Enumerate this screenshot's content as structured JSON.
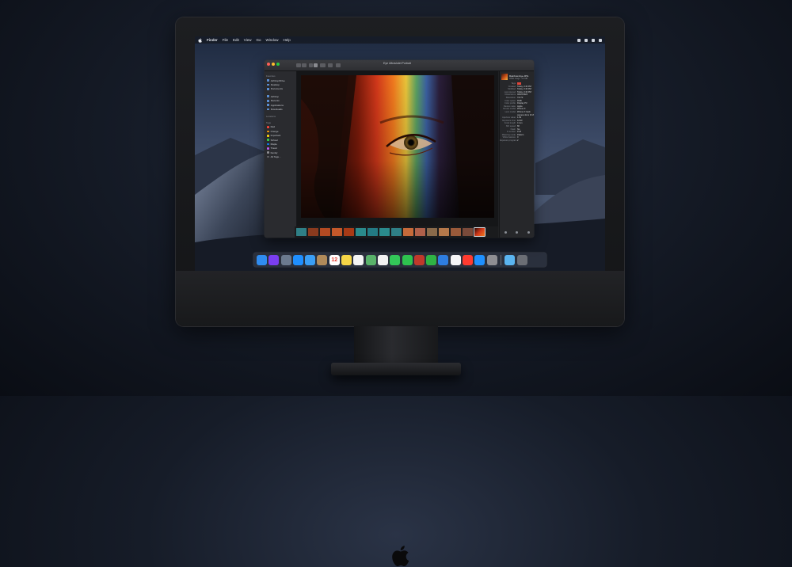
{
  "menubar": {
    "app_name": "Finder",
    "items": [
      "File",
      "Edit",
      "View",
      "Go",
      "Window",
      "Help"
    ]
  },
  "window": {
    "title": "Eye Ultraviolet Portrait",
    "sidebar": {
      "sections": [
        {
          "title": "Favorites",
          "items": [
            "AirDrop/Drive",
            "Desktop",
            "Documents"
          ]
        },
        {
          "title": "",
          "items": [
            "AirDrop",
            "Recents",
            "Applications",
            "Downloads"
          ]
        },
        {
          "title": "Locations",
          "items": []
        },
        {
          "title": "Tags",
          "tags": [
            {
              "label": "Red",
              "color": "#ff453a"
            },
            {
              "label": "Orange",
              "color": "#ff9f0a"
            },
            {
              "label": "Important",
              "color": "#ffd60a"
            },
            {
              "label": "School",
              "color": "#32d74b"
            },
            {
              "label": "Maple",
              "color": "#0a84ff"
            },
            {
              "label": "Travel",
              "color": "#bf5af2"
            },
            {
              "label": "Family",
              "color": "#8e8e93"
            },
            {
              "label": "All Tags...",
              "color": "#636366"
            }
          ]
        }
      ]
    },
    "inspector": {
      "file_name": "Rainbow Eye.JPG",
      "file_info": "JPEG image · 9.6 MB",
      "rows": [
        {
          "k": "Tags",
          "v": ""
        },
        {
          "k": "Created",
          "v": "Today, 3:40 PM"
        },
        {
          "k": "Modified",
          "v": "Today, 3:40 PM"
        },
        {
          "k": "Last opened",
          "v": "Today, 3:40 PM"
        },
        {
          "k": "Dimensions",
          "v": "4032×3024"
        },
        {
          "k": "Resolution",
          "v": "72×72"
        },
        {
          "k": "Color space",
          "v": "RGB"
        },
        {
          "k": "Color profile",
          "v": "Display P3"
        },
        {
          "k": "Device make",
          "v": "Apple"
        },
        {
          "k": "Device model",
          "v": "iPhone X"
        },
        {
          "k": "Lens model",
          "v": "iPhone X back"
        },
        {
          "k": "",
          "v": "camera 4mm f/1.8"
        },
        {
          "k": "Aperture value",
          "v": "1.69"
        },
        {
          "k": "Exposure time",
          "v": "1/120"
        },
        {
          "k": "Focal length",
          "v": "4 mm"
        },
        {
          "k": "ISO speed",
          "v": "80"
        },
        {
          "k": "Flash",
          "v": "No"
        },
        {
          "k": "F number",
          "v": "f/1.8"
        },
        {
          "k": "Metering mode",
          "v": "Pattern"
        },
        {
          "k": "White balance",
          "v": "0"
        },
        {
          "k": "Exposure program",
          "v": "2"
        }
      ]
    },
    "thumbnail_count": 16,
    "selected_thumbnail": 15
  },
  "dock": {
    "apps": [
      {
        "name": "Finder",
        "color": "#2f8cf0",
        "glyph": ""
      },
      {
        "name": "Siri",
        "color": "#7a3ef0",
        "glyph": ""
      },
      {
        "name": "Launchpad",
        "color": "#6b7a8f",
        "glyph": ""
      },
      {
        "name": "Safari",
        "color": "#1f8fff",
        "glyph": ""
      },
      {
        "name": "Mail",
        "color": "#3a9ef5",
        "glyph": ""
      },
      {
        "name": "Contacts",
        "color": "#b08a5a",
        "glyph": ""
      },
      {
        "name": "Calendar",
        "color": "#ffffff",
        "glyph": "12"
      },
      {
        "name": "Notes",
        "color": "#f5d547",
        "glyph": ""
      },
      {
        "name": "Reminders",
        "color": "#f4f4f4",
        "glyph": ""
      },
      {
        "name": "Maps",
        "color": "#59b26a",
        "glyph": ""
      },
      {
        "name": "Photos",
        "color": "#f2f2f2",
        "glyph": ""
      },
      {
        "name": "Messages",
        "color": "#33c759",
        "glyph": ""
      },
      {
        "name": "FaceTime",
        "color": "#2ec24f",
        "glyph": ""
      },
      {
        "name": "Photo Booth",
        "color": "#c0392b",
        "glyph": ""
      },
      {
        "name": "Numbers",
        "color": "#2fb344",
        "glyph": ""
      },
      {
        "name": "Keynote",
        "color": "#2e7de0",
        "glyph": ""
      },
      {
        "name": "iTunes",
        "color": "#f5f5f7",
        "glyph": ""
      },
      {
        "name": "News",
        "color": "#ff3b30",
        "glyph": ""
      },
      {
        "name": "App Store",
        "color": "#1e90ff",
        "glyph": ""
      },
      {
        "name": "System Preferences",
        "color": "#8e8e93",
        "glyph": ""
      }
    ],
    "right": [
      {
        "name": "Downloads",
        "color": "#5ab4f0"
      },
      {
        "name": "Trash",
        "color": "#6b6e75"
      }
    ]
  }
}
